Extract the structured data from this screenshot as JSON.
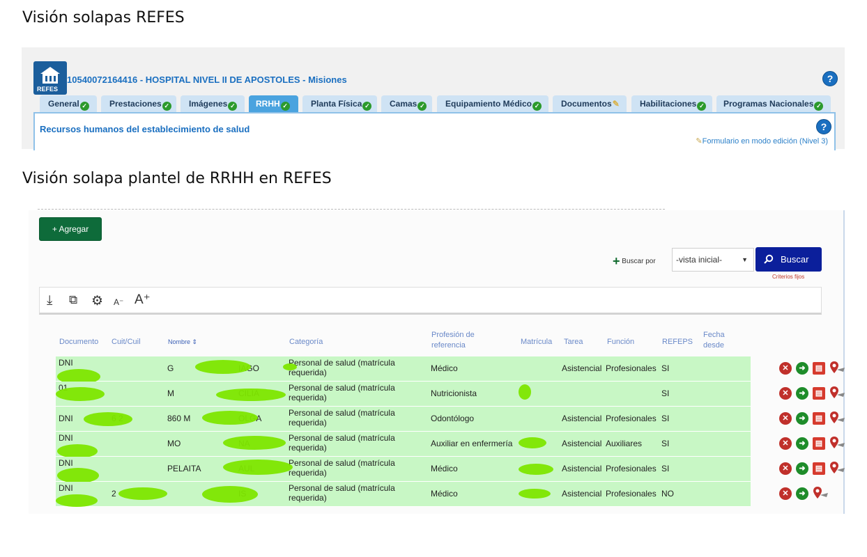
{
  "headings": {
    "top": "Visión solapas REFES",
    "bottom": "Visión solapa plantel de RRHH en REFES"
  },
  "refes": {
    "logo_text": "REFES",
    "hospital_title": "10540072164416 - HOSPITAL NIVEL II DE APOSTOLES - Misiones",
    "help_glyph": "?",
    "tabs": [
      {
        "label": "General",
        "status": "check"
      },
      {
        "label": "Prestaciones",
        "status": "check"
      },
      {
        "label": "Imágenes",
        "status": "check"
      },
      {
        "label": "RRHH",
        "status": "check",
        "active": true
      },
      {
        "label": "Planta Física",
        "status": "check"
      },
      {
        "label": "Camas",
        "status": "check"
      },
      {
        "label": "Equipamiento Médico",
        "status": "check"
      },
      {
        "label": "Documentos",
        "status": "edit"
      },
      {
        "label": "Habilitaciones",
        "status": "check"
      },
      {
        "label": "Programas Nacionales",
        "status": "check"
      }
    ],
    "section_title": "Recursos humanos del establecimiento de salud",
    "form_mode": "Formulario en modo edición (Nivel 3)"
  },
  "plantel": {
    "add_button": "+ Agregar",
    "search_by_label": "Buscar por",
    "search_select_value": "-vista inicial-",
    "search_button": "Buscar",
    "criteria_link": "Criterios fijos",
    "toolbar_icons": [
      "download-icon",
      "zoom-page-icon",
      "settings-gear-icon",
      "font-decrease-icon",
      "font-increase-icon"
    ],
    "columns": [
      "Documento",
      "Cuit/Cuil",
      "Nombre",
      "Categoría",
      "Profesión de referencia",
      "Matrícula",
      "Tarea",
      "Función",
      "REFEPS",
      "Fecha desde"
    ],
    "sort_indicator": "⇕",
    "rows": [
      {
        "documento": "DNI",
        "cuit": "",
        "nombre": "IAGO",
        "nombre_prefix": "G",
        "categoria": "Personal de salud (matrícula requerida)",
        "profesion": "Médico",
        "tarea": "Asistencial",
        "funcion": "Profesionales",
        "refeps": "SI",
        "pdf": true
      },
      {
        "documento": "01",
        "cuit": "",
        "nombre": "CILIA",
        "nombre_prefix": "M",
        "categoria": "Personal de salud (matrícula requerida)",
        "profesion": "Nutricionista",
        "tarea": "",
        "funcion": "",
        "refeps": "SI",
        "pdf": true
      },
      {
        "documento": "DNI",
        "cuit": "6 2",
        "nombre": "OLGA",
        "nombre_prefix": "860 M",
        "categoria": "Personal de salud (matrícula requerida)",
        "profesion": "Odontólogo",
        "tarea": "Asistencial",
        "funcion": "Profesionales",
        "refeps": "SI",
        "pdf": true
      },
      {
        "documento": "DNI",
        "cuit": "",
        "nombre": "NA",
        "nombre_prefix": "MO",
        "categoria": "Personal de salud (matrícula requerida)",
        "profesion": "Auxiliar en enfermería",
        "tarea": "Asistencial",
        "funcion": "Auxiliares",
        "refeps": "SI",
        "pdf": true
      },
      {
        "documento": "DNI",
        "cuit": "",
        "nombre": "AUL",
        "nombre_prefix": "PELAITA",
        "categoria": "Personal de salud (matrícula requerida)",
        "profesion": "Médico",
        "tarea": "Asistencial",
        "funcion": "Profesionales",
        "refeps": "SI",
        "pdf": true
      },
      {
        "documento": "DNI",
        "cuit": "2",
        "nombre": "IS",
        "nombre_prefix": "",
        "categoria": "Personal de salud (matrícula requerida)",
        "profesion": "Médico",
        "tarea": "Asistencial",
        "funcion": "Profesionales",
        "refeps": "NO",
        "pdf": false
      }
    ]
  },
  "colors": {
    "accent": "#1a6fc0",
    "row_bg": "#c8f7c5",
    "redaction": "#7ee600",
    "add_button": "#0e6b3a",
    "search_button": "#0b1f9b"
  }
}
